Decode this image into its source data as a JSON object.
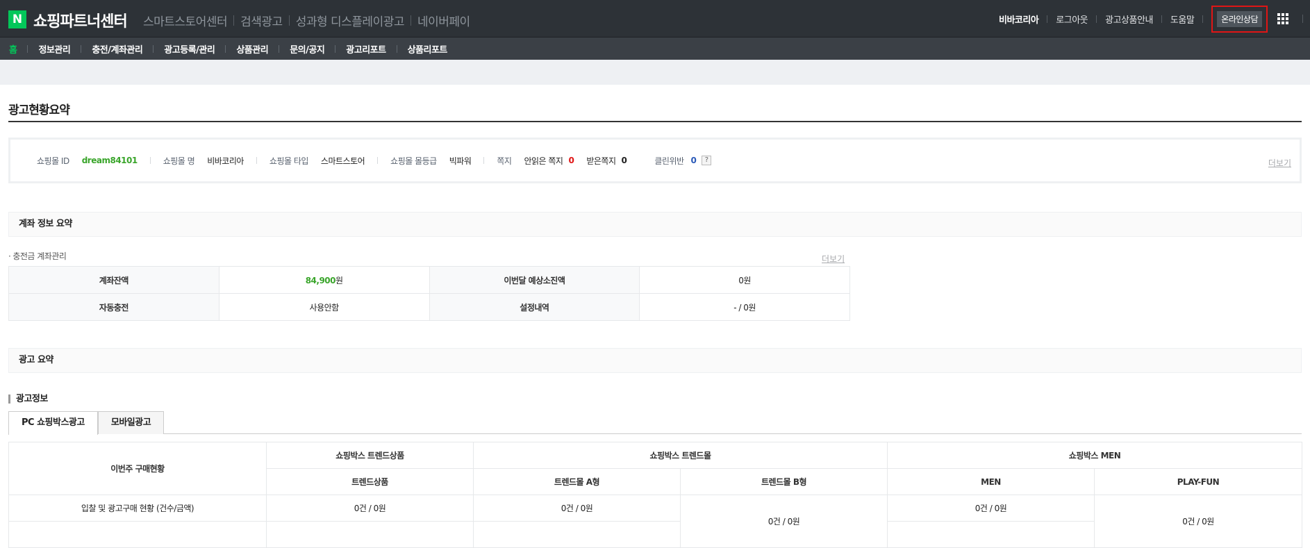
{
  "header": {
    "logo_letter": "N",
    "brand": "쇼핑파트너센터",
    "services": [
      "스마트스토어센터",
      "검색광고",
      "성과형 디스플레이광고",
      "네이버페이"
    ],
    "util": {
      "user": "비바코리아",
      "logout": "로그아웃",
      "ad_guide": "광고상품안내",
      "help": "도움말",
      "consult": "온라인상담"
    }
  },
  "menu": {
    "home": "홈",
    "items": [
      "정보관리",
      "충전/계좌관리",
      "광고등록/관리",
      "상품관리",
      "문의/공지",
      "광고리포트",
      "상품리포트"
    ]
  },
  "page": {
    "title": "광고현황요약"
  },
  "shop_info": {
    "id_label": "쇼핑몰 ID",
    "id_value": "dream84101",
    "name_label": "쇼핑몰 명",
    "name_value": "비바코리아",
    "type_label": "쇼핑몰 타입",
    "type_value": "스마트스토어",
    "grade_label": "쇼핑몰 몰등급",
    "grade_value": "빅파워",
    "note_label": "쪽지",
    "unread_label": "안읽은 쪽지",
    "unread_value": "0",
    "received_label": "받은쪽지",
    "received_value": "0",
    "clean_label": "클린위반",
    "clean_value": "0",
    "help_mark": "?",
    "more": "더보기"
  },
  "account": {
    "section_title": "계좌 정보 요약",
    "subheading": "충전금 계좌관리",
    "more": "더보기",
    "rows": [
      {
        "label1": "계좌잔액",
        "value1_num": "84,900",
        "value1_unit": "원",
        "label2": "이번달 예상소진액",
        "value2": "0원"
      },
      {
        "label1": "자동충전",
        "value1": "사용안함",
        "label2": "설정내역",
        "value2": "- / 0원"
      }
    ]
  },
  "ad_summary": {
    "section_title": "광고 요약",
    "info_title": "광고정보",
    "tabs": [
      "PC 쇼핑박스광고",
      "모바일광고"
    ],
    "header_row_label": "이번주 구매현황",
    "groups": [
      "쇼핑박스 트렌드상품",
      "쇼핑박스 트렌드몰",
      "쇼핑박스 MEN"
    ],
    "subcolumns": [
      "트렌드상품",
      "트렌드몰 A형",
      "트렌드몰 B형",
      "MEN",
      "PLAY-FUN"
    ],
    "row1_label": "입찰 및 광고구매 현황 (건수/금액)",
    "row1_values": [
      "0건 / 0원",
      "0건 / 0원",
      "0건 / 0원",
      "0건 / 0원",
      "0건 / 0원"
    ]
  }
}
